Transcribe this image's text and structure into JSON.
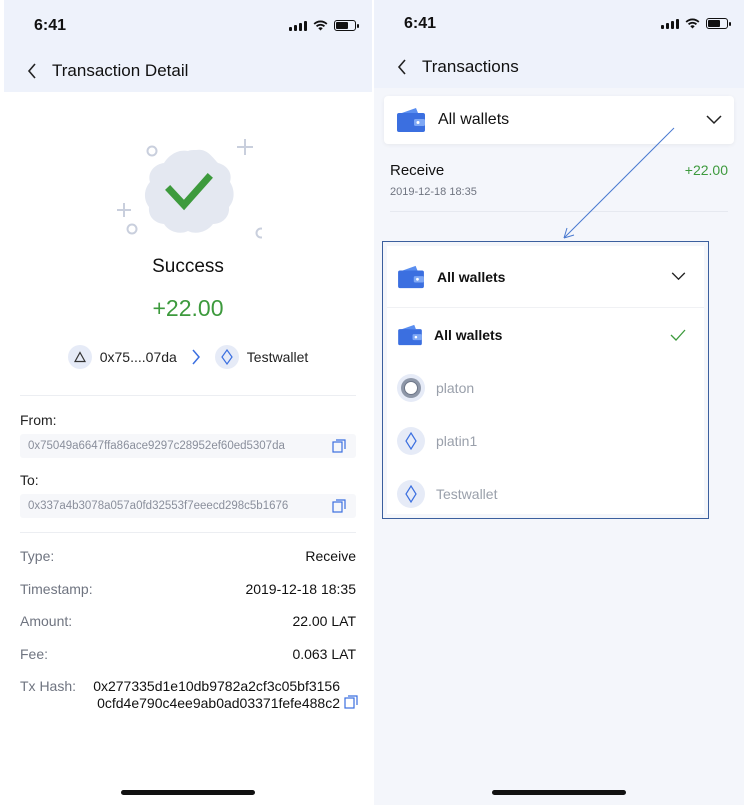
{
  "left_screen": {
    "status_bar": {
      "time": "6:41"
    },
    "nav": {
      "title": "Transaction Detail"
    },
    "hero": {
      "status": "Success",
      "amount": "+22.00",
      "from_short": "0x75....07da",
      "to_name": "Testwallet"
    },
    "from": {
      "label": "From:",
      "address": "0x75049a6647ffa86ace9297c28952ef60ed5307da"
    },
    "to": {
      "label": "To:",
      "address": "0x337a4b3078a057a0fd32553f7eeecd298c5b1676"
    },
    "details": [
      {
        "label": "Type:",
        "value": "Receive"
      },
      {
        "label": "Timestamp:",
        "value": "2019-12-18 18:35"
      },
      {
        "label": "Amount:",
        "value": "22.00 LAT"
      },
      {
        "label": "Fee:",
        "value": "0.063 LAT"
      }
    ],
    "tx_hash": {
      "label": "Tx Hash:",
      "value": "0x277335d1e10db9782a2cf3c05bf31560cfd4e790c4ee9ab0ad03371fefe488c2"
    }
  },
  "right_screen": {
    "status_bar": {
      "time": "6:41"
    },
    "nav": {
      "title": "Transactions"
    },
    "wallet_selector": {
      "label": "All wallets"
    },
    "transaction": {
      "type": "Receive",
      "timestamp": "2019-12-18 18:35",
      "amount": "+22.00"
    },
    "dropdown": {
      "header_label": "All wallets",
      "items": [
        {
          "label": "All wallets",
          "icon": "wallet-icon",
          "selected": true
        },
        {
          "label": "platon",
          "icon": "ring-icon",
          "selected": false
        },
        {
          "label": "platin1",
          "icon": "diamond-icon",
          "selected": false
        },
        {
          "label": "Testwallet",
          "icon": "diamond-icon",
          "selected": false
        }
      ]
    }
  },
  "colors": {
    "success_green": "#3d9a3d",
    "accent_blue": "#3b6fe0",
    "header_bg": "#eef2fb",
    "annotation_blue": "#3b5f9e"
  }
}
